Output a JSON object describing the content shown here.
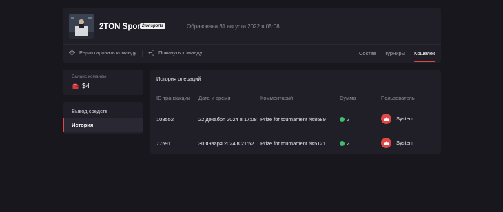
{
  "team": {
    "name": "2TON Sports",
    "tag": "2tonsports",
    "created": "Образована 31 августа 2022 в 05:08"
  },
  "header": {
    "edit_label": "Редактировать команду",
    "leave_label": "Покинуть команду",
    "tabs": [
      {
        "label": "Состав"
      },
      {
        "label": "Турниры"
      },
      {
        "label": "Кошелёк",
        "active": true
      }
    ]
  },
  "balance": {
    "label": "Баланс команды:",
    "value": "$4"
  },
  "menu": {
    "items": [
      {
        "label": "Вывод средств"
      },
      {
        "label": "История",
        "active": true
      }
    ]
  },
  "history": {
    "title": "История операций",
    "columns": [
      "ID транзакции",
      "Дата и время",
      "Комментарий",
      "Сумма",
      "Пользователь"
    ],
    "rows": [
      {
        "id": "108552",
        "datetime": "22 декабря 2024 в 17:08",
        "comment": "Prize for tournament №8589",
        "amount": "2",
        "user": "System"
      },
      {
        "id": "77591",
        "datetime": "30 января 2024 в 21:52",
        "comment": "Prize for tournament №5121",
        "amount": "2",
        "user": "System"
      }
    ]
  },
  "colors": {
    "accent": "#e04848",
    "coin": "#3fbf6a",
    "background": "#18171d",
    "panel": "#201f27"
  },
  "icons": {
    "edit": "gear-icon",
    "leave": "logout-icon",
    "balance": "wallet-icon",
    "amount": "coin-icon",
    "user": "crown-icon"
  }
}
